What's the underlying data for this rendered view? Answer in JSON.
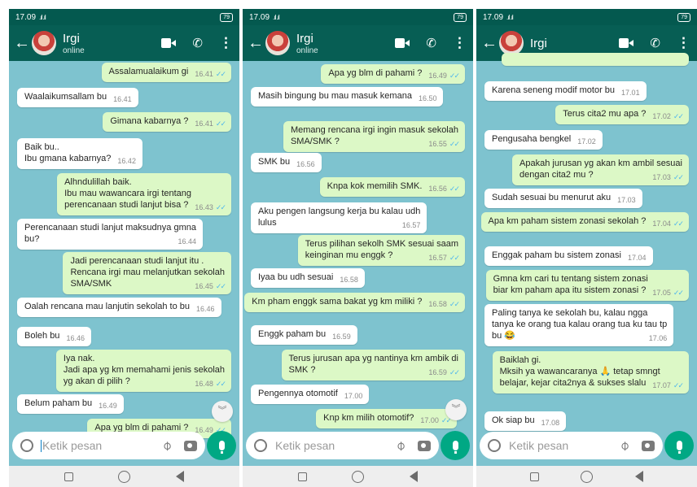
{
  "status_bar": {
    "time": "17.09",
    "signal": ".ıl .ıl",
    "battery": "79"
  },
  "input": {
    "placeholder": "Ketik pesan"
  },
  "panels": [
    {
      "contact": "Irgi",
      "contact_status": "online",
      "messages": [
        {
          "dir": "out",
          "text": "Assalamualaikum gi",
          "time": "16.41"
        },
        {
          "dir": "in",
          "text": "Waalaikumsallam bu",
          "time": "16.41"
        },
        {
          "dir": "out",
          "text": "Gimana kabarnya ?",
          "time": "16.41"
        },
        {
          "dir": "in",
          "text": "Baik bu..\nIbu gmana kabarnya?",
          "time": "16.42"
        },
        {
          "dir": "out",
          "text": "Alhndulillah baik.\nIbu mau wawancara irgi tentang\nperencanaan studi lanjut bisa ?",
          "time": "16.43"
        },
        {
          "dir": "in",
          "text": "Perencanaan studi lanjut maksudnya gmna\nbu?",
          "time": "16.44"
        },
        {
          "dir": "out",
          "text": "Jadi perencanaan studi lanjut itu .\nRencana irgi mau melanjutkan sekolah\nSMA/SMK",
          "time": "16.45"
        },
        {
          "dir": "in",
          "text": "Oalah rencana mau lanjutin sekolah to bu",
          "time": "16.46"
        },
        {
          "dir": "in",
          "text": "Boleh bu",
          "time": "16.46"
        },
        {
          "dir": "out",
          "text": "Iya nak.\nJadi apa yg km memahami jenis sekolah\nyg akan di pilih ?",
          "time": "16.48"
        },
        {
          "dir": "in",
          "text": "Belum paham bu",
          "time": "16.49"
        },
        {
          "dir": "out",
          "text": "Apa yg blm di pahami ?",
          "time": "16.49"
        }
      ]
    },
    {
      "contact": "Irgi",
      "contact_status": "online",
      "messages": [
        {
          "dir": "out",
          "text": "Apa yg blm di pahami ?",
          "time": "16.49"
        },
        {
          "dir": "in",
          "text": "Masih bingung bu mau masuk kemana",
          "time": "16.50"
        },
        {
          "dir": "out",
          "text": "Memang rencana irgi ingin masuk sekolah\nSMA/SMK ?",
          "time": "16.55"
        },
        {
          "dir": "in",
          "text": "SMK bu",
          "time": "16.56"
        },
        {
          "dir": "out",
          "text": "Knpa kok memilih SMK.",
          "time": "16.56"
        },
        {
          "dir": "in",
          "text": "Aku pengen langsung kerja bu kalau udh\nlulus",
          "time": "16.57"
        },
        {
          "dir": "out",
          "text": "Terus pilihan sekolh SMK sesuai saam\nkeinginan mu enggk ?",
          "time": "16.57"
        },
        {
          "dir": "in",
          "text": "Iyaa bu udh sesuai",
          "time": "16.58"
        },
        {
          "dir": "out",
          "text": "Km pham enggk sama bakat yg km miliki ?",
          "time": "16.58"
        },
        {
          "dir": "in",
          "text": "Enggk paham bu",
          "time": "16.59"
        },
        {
          "dir": "out",
          "text": "Terus jurusan apa yg nantinya km ambik di\nSMK ?",
          "time": "16.59"
        },
        {
          "dir": "in",
          "text": "Pengennya otomotif",
          "time": "17.00"
        },
        {
          "dir": "out",
          "text": "Knp km milih otomotif?",
          "time": "17.00"
        }
      ]
    },
    {
      "contact": "Irgi",
      "contact_status": "",
      "messages": [
        {
          "dir": "in",
          "text": "Karena seneng modif motor bu",
          "time": "17.01"
        },
        {
          "dir": "out",
          "text": "Terus cita2 mu apa ?",
          "time": "17.02"
        },
        {
          "dir": "in",
          "text": "Pengusaha bengkel",
          "time": "17.02"
        },
        {
          "dir": "out",
          "text": "Apakah jurusan yg akan km ambil sesuai\ndengan cita2 mu ?",
          "time": "17.03"
        },
        {
          "dir": "in",
          "text": "Sudah sesuai bu menurut aku",
          "time": "17.03"
        },
        {
          "dir": "out",
          "text": "Apa km paham sistem zonasi sekolah ?",
          "time": "17.04"
        },
        {
          "dir": "in",
          "text": "Enggak paham bu sistem zonasi",
          "time": "17.04"
        },
        {
          "dir": "out",
          "text": "Gmna km cari tu tentang sistem zonasi\nbiar km paham apa itu sistem zonasi ?",
          "time": "17.05"
        },
        {
          "dir": "in",
          "text": "Paling tanya ke sekolah bu, kalau ngga\ntanya ke orang tua kalau orang tua ku tau tp\nbu 😂",
          "time": "17.06"
        },
        {
          "dir": "out",
          "text": "Baiklah gi.\nMksih ya wawancaranya 🙏 tetap smngt\nbelajar, kejar cita2nya & sukses slalu",
          "time": "17.07"
        },
        {
          "dir": "in",
          "text": "Ok siap bu",
          "time": "17.08"
        }
      ]
    }
  ]
}
